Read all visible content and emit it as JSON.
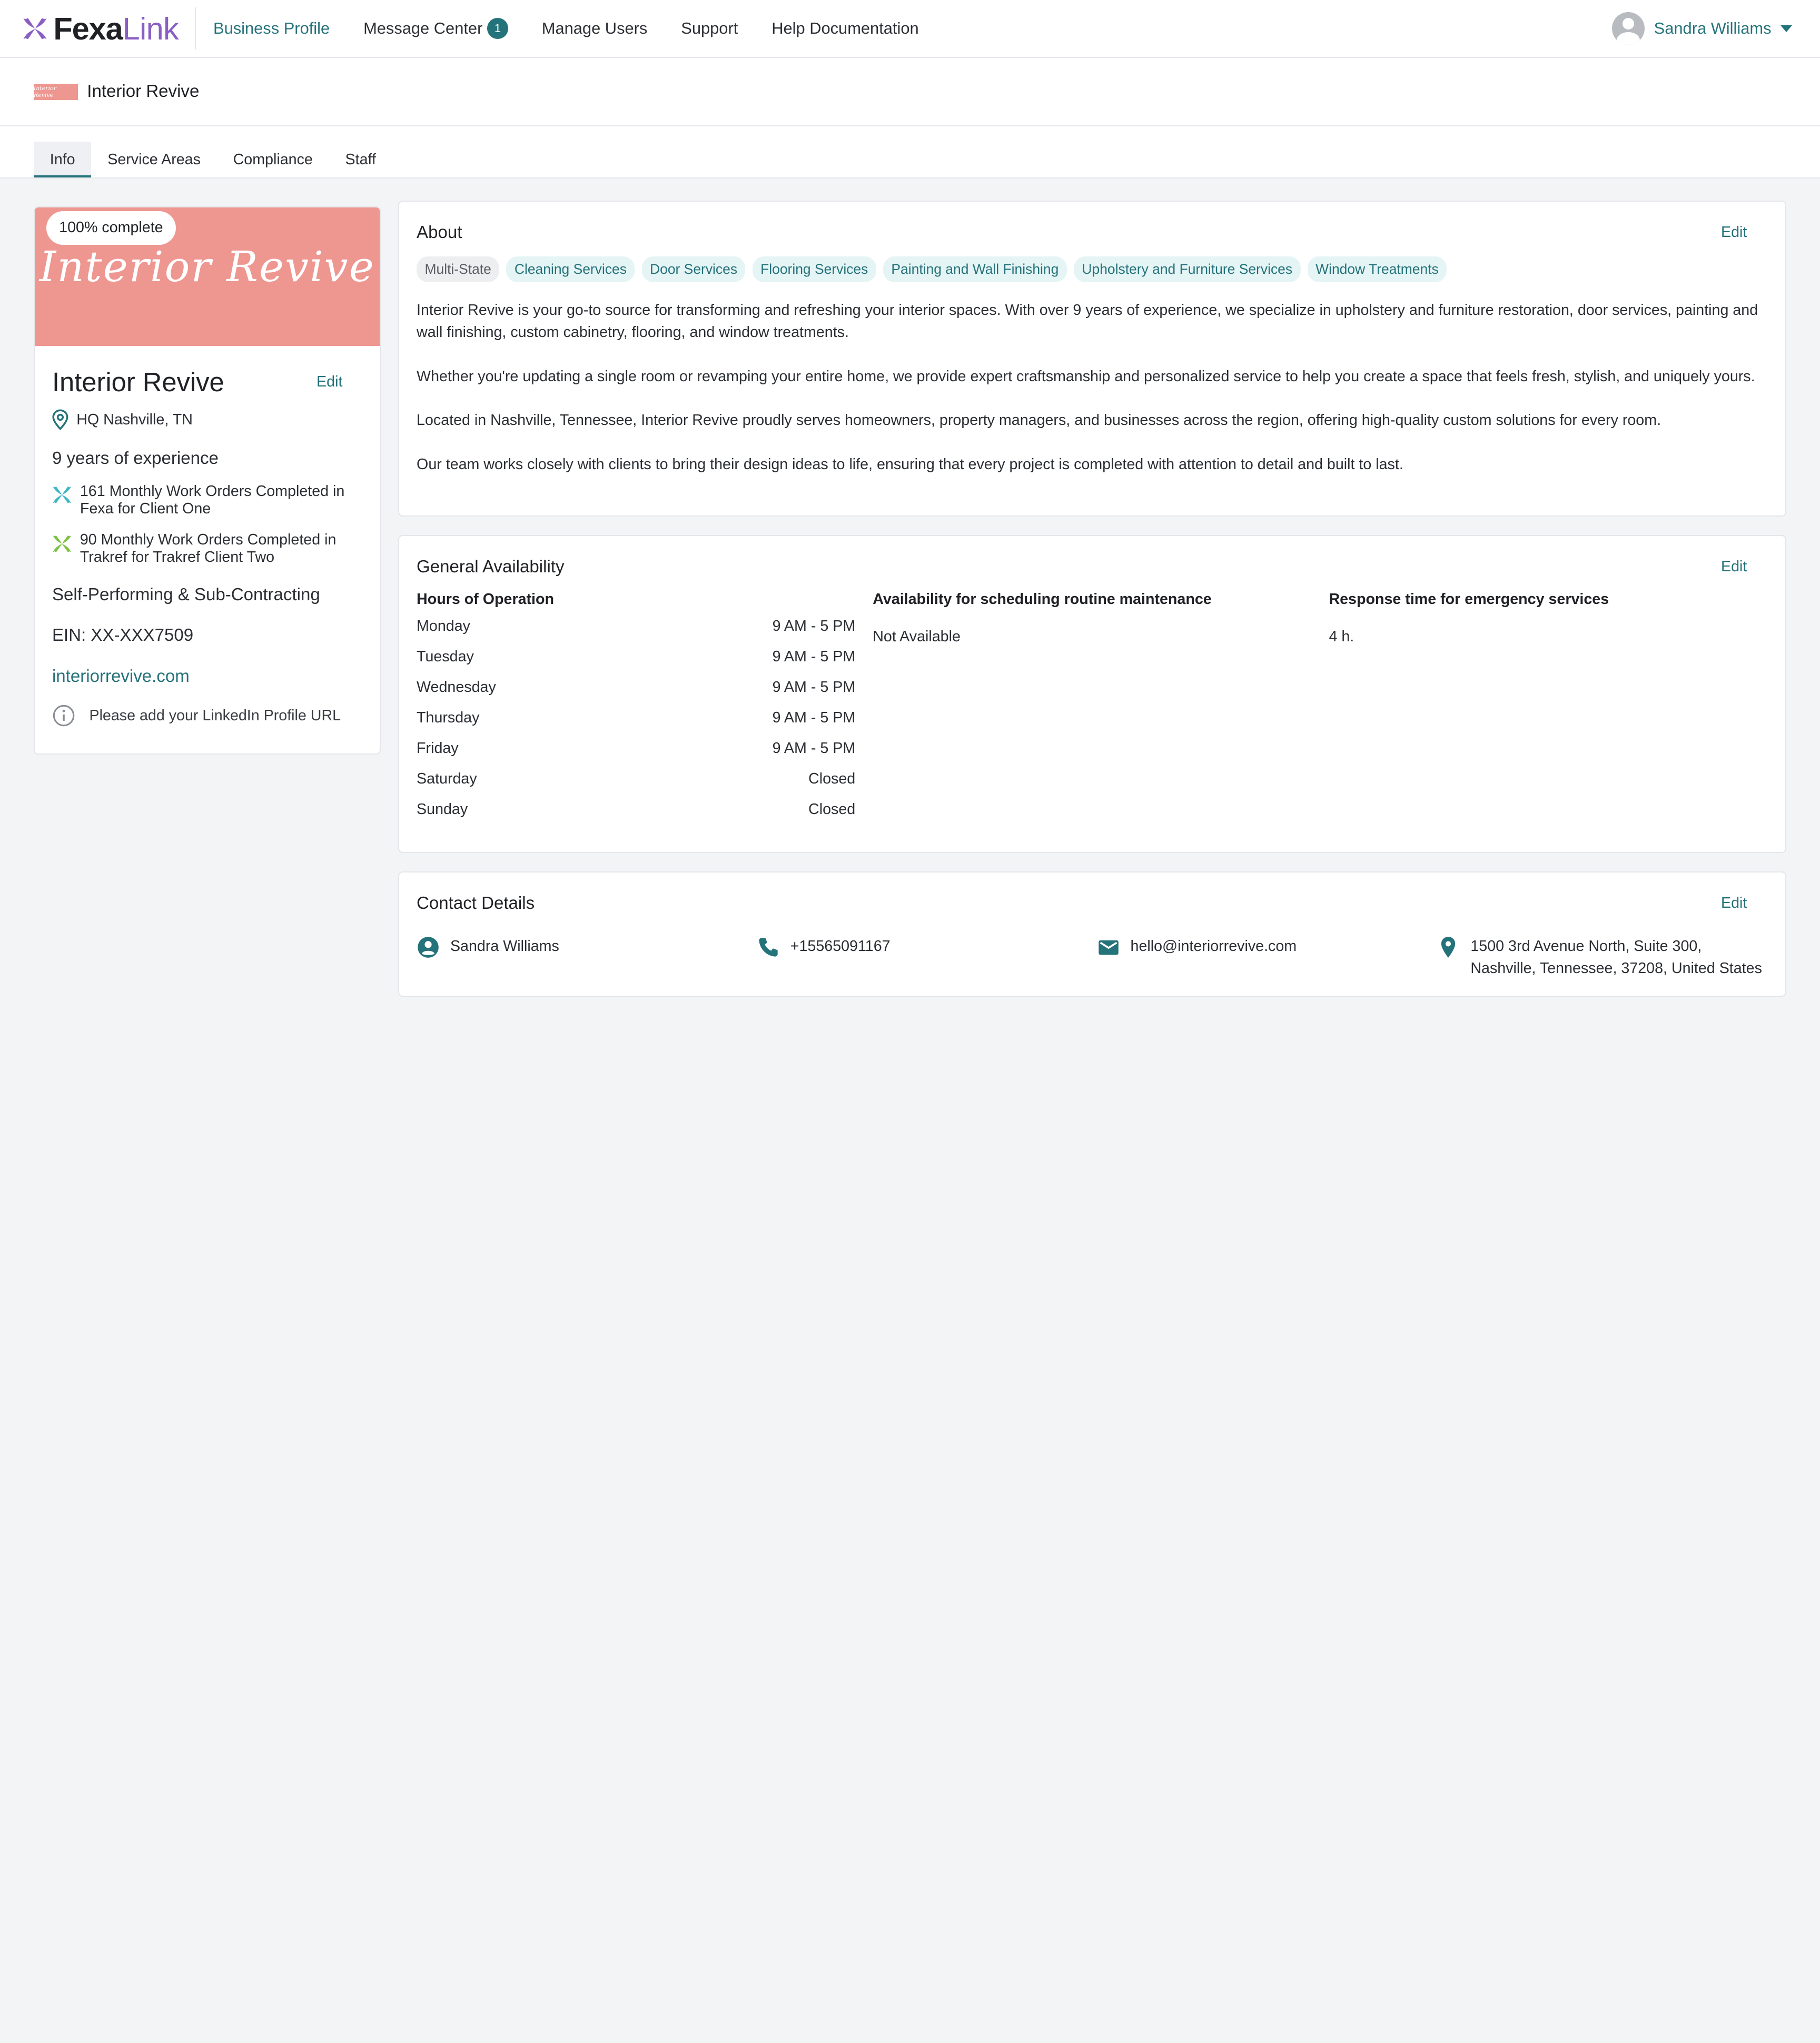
{
  "nav": {
    "logo_main": "Fexa",
    "logo_secondary": "Link",
    "links": [
      {
        "label": "Business Profile"
      },
      {
        "label": "Message Center"
      },
      {
        "label": "Manage Users"
      },
      {
        "label": "Support"
      },
      {
        "label": "Help Documentation"
      }
    ],
    "message_count": "1",
    "user_name": "Sandra Williams"
  },
  "company": {
    "name": "Interior Revive",
    "mini_logo_text": "Interior Revive"
  },
  "tabs": [
    {
      "label": "Info"
    },
    {
      "label": "Service Areas"
    },
    {
      "label": "Compliance"
    },
    {
      "label": "Staff"
    }
  ],
  "profile": {
    "completion": "100% complete",
    "banner_title": "Interior Revive",
    "name": "Interior Revive",
    "edit_label": "Edit",
    "hq": "HQ Nashville, TN",
    "experience": "9 years of experience",
    "work_orders": [
      {
        "text": "161 Monthly Work Orders Completed in Fexa for Client One",
        "icon": "fexa-logo-icon",
        "color": "#3fb6c4"
      },
      {
        "text": "90 Monthly Work Orders Completed in Trakref for Trakref Client Two",
        "icon": "trakref-logo-icon",
        "color": "#7dc242"
      }
    ],
    "performing": "Self-Performing & Sub-Contracting",
    "ein": "EIN: XX-XXX7509",
    "website": "interiorrevive.com",
    "linkedin_notice": "Please add your LinkedIn Profile URL"
  },
  "about": {
    "title": "About",
    "edit_label": "Edit",
    "chips": [
      {
        "label": "Multi-State",
        "style": "neutral"
      },
      {
        "label": "Cleaning Services",
        "style": "accent"
      },
      {
        "label": "Door Services",
        "style": "accent"
      },
      {
        "label": "Flooring Services",
        "style": "accent"
      },
      {
        "label": "Painting and Wall Finishing",
        "style": "accent"
      },
      {
        "label": "Upholstery and Furniture Services",
        "style": "accent"
      },
      {
        "label": "Window Treatments",
        "style": "accent"
      }
    ],
    "paragraphs": [
      "Interior Revive is your go-to source for transforming and refreshing your interior spaces. With over 9 years of experience, we specialize in upholstery and furniture restoration, door services, painting and wall finishing, custom cabinetry, flooring, and window treatments.",
      "Whether you're updating a single room or revamping your entire home, we provide expert craftsmanship and personalized service to help you create a space that feels fresh, stylish, and uniquely yours.",
      "Located in Nashville, Tennessee, Interior Revive proudly serves homeowners, property managers, and businesses across the region, offering high-quality custom solutions for every room.",
      "Our team works closely with clients to bring their design ideas to life, ensuring that every project is completed with attention to detail and built to last."
    ]
  },
  "availability": {
    "title": "General Availability",
    "edit_label": "Edit",
    "hours_heading": "Hours of Operation",
    "hours": [
      {
        "day": "Monday",
        "time": "9 AM - 5 PM"
      },
      {
        "day": "Tuesday",
        "time": "9 AM - 5 PM"
      },
      {
        "day": "Wednesday",
        "time": "9 AM - 5 PM"
      },
      {
        "day": "Thursday",
        "time": "9 AM - 5 PM"
      },
      {
        "day": "Friday",
        "time": "9 AM - 5 PM"
      },
      {
        "day": "Saturday",
        "time": "Closed"
      },
      {
        "day": "Sunday",
        "time": "Closed"
      }
    ],
    "routine_heading": "Availability for scheduling routine maintenance",
    "routine_value": "Not Available",
    "emergency_heading": "Response time for emergency services",
    "emergency_value": "4 h."
  },
  "contact": {
    "title": "Contact Details",
    "edit_label": "Edit",
    "name": "Sandra Williams",
    "phone": "+15565091167",
    "email": "hello@interiorrevive.com",
    "address_line1": "1500 3rd Avenue North, Suite 300,",
    "address_line2": "Nashville, Tennessee, 37208, United States"
  },
  "colors": {
    "accent": "#24727a",
    "brand_purple": "#8a5ec4",
    "banner": "#ee9690"
  }
}
